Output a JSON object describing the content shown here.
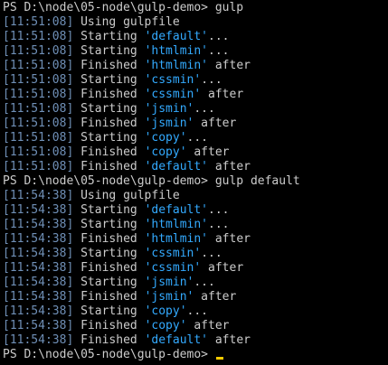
{
  "terminal": {
    "lines": [
      {
        "kind": "prompt",
        "prompt": "PS D:\\node\\05-node\\gulp-demo> ",
        "command": "gulp"
      },
      {
        "kind": "log",
        "time": "[11:51:08]",
        "text": " Using gulpfile"
      },
      {
        "kind": "task",
        "time": "[11:51:08]",
        "verb": " Starting ",
        "task": "'default'",
        "suffix": "..."
      },
      {
        "kind": "task",
        "time": "[11:51:08]",
        "verb": " Starting ",
        "task": "'htmlmin'",
        "suffix": "..."
      },
      {
        "kind": "task",
        "time": "[11:51:08]",
        "verb": " Finished ",
        "task": "'htmlmin'",
        "suffix": " after"
      },
      {
        "kind": "task",
        "time": "[11:51:08]",
        "verb": " Starting ",
        "task": "'cssmin'",
        "suffix": "..."
      },
      {
        "kind": "task",
        "time": "[11:51:08]",
        "verb": " Finished ",
        "task": "'cssmin'",
        "suffix": " after"
      },
      {
        "kind": "task",
        "time": "[11:51:08]",
        "verb": " Starting ",
        "task": "'jsmin'",
        "suffix": "..."
      },
      {
        "kind": "task",
        "time": "[11:51:08]",
        "verb": " Finished ",
        "task": "'jsmin'",
        "suffix": " after"
      },
      {
        "kind": "task",
        "time": "[11:51:08]",
        "verb": " Starting ",
        "task": "'copy'",
        "suffix": "..."
      },
      {
        "kind": "task",
        "time": "[11:51:08]",
        "verb": " Finished ",
        "task": "'copy'",
        "suffix": " after"
      },
      {
        "kind": "task",
        "time": "[11:51:08]",
        "verb": " Finished ",
        "task": "'default'",
        "suffix": " after"
      },
      {
        "kind": "prompt",
        "prompt": "PS D:\\node\\05-node\\gulp-demo> ",
        "command": "gulp default"
      },
      {
        "kind": "log",
        "time": "[11:54:38]",
        "text": " Using gulpfile"
      },
      {
        "kind": "task",
        "time": "[11:54:38]",
        "verb": " Starting ",
        "task": "'default'",
        "suffix": "..."
      },
      {
        "kind": "task",
        "time": "[11:54:38]",
        "verb": " Starting ",
        "task": "'htmlmin'",
        "suffix": "..."
      },
      {
        "kind": "task",
        "time": "[11:54:38]",
        "verb": " Finished ",
        "task": "'htmlmin'",
        "suffix": " after"
      },
      {
        "kind": "task",
        "time": "[11:54:38]",
        "verb": " Starting ",
        "task": "'cssmin'",
        "suffix": "..."
      },
      {
        "kind": "task",
        "time": "[11:54:38]",
        "verb": " Finished ",
        "task": "'cssmin'",
        "suffix": " after"
      },
      {
        "kind": "task",
        "time": "[11:54:38]",
        "verb": " Starting ",
        "task": "'jsmin'",
        "suffix": "..."
      },
      {
        "kind": "task",
        "time": "[11:54:38]",
        "verb": " Finished ",
        "task": "'jsmin'",
        "suffix": " after"
      },
      {
        "kind": "task",
        "time": "[11:54:38]",
        "verb": " Starting ",
        "task": "'copy'",
        "suffix": "..."
      },
      {
        "kind": "task",
        "time": "[11:54:38]",
        "verb": " Finished ",
        "task": "'copy'",
        "suffix": " after"
      },
      {
        "kind": "task",
        "time": "[11:54:38]",
        "verb": " Finished ",
        "task": "'default'",
        "suffix": " after"
      },
      {
        "kind": "prompt",
        "prompt": "PS D:\\node\\05-node\\gulp-demo> ",
        "command": ""
      }
    ],
    "colors": {
      "background": "#000000",
      "text": "#cccccc",
      "timestamp": "#6f8fb6",
      "task_name": "#33aaff",
      "cursor": "#ffcc00"
    }
  }
}
